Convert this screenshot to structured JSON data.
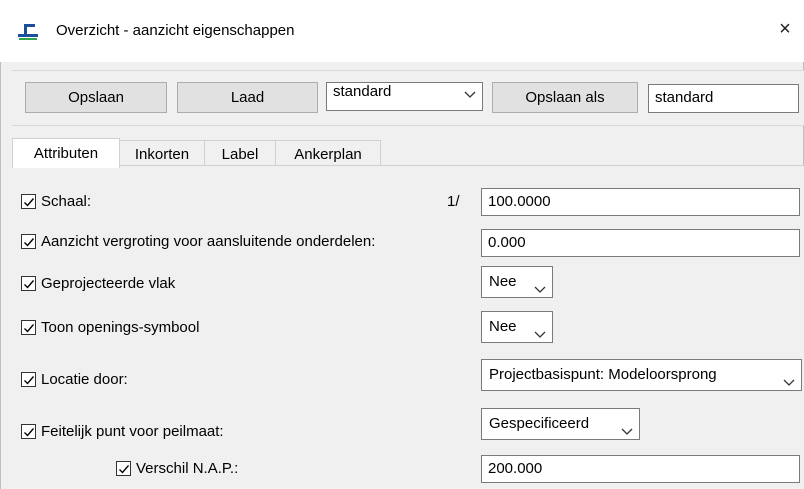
{
  "window": {
    "title": "Overzicht - aanzicht eigenschappen",
    "close_glyph": "×"
  },
  "toolbar": {
    "save_label": "Opslaan",
    "load_label": "Laad",
    "preset_select": "standard",
    "save_as_label": "Opslaan als",
    "save_as_name": "standard"
  },
  "tabs": [
    {
      "label": "Attributen",
      "active": true
    },
    {
      "label": "Inkorten",
      "active": false
    },
    {
      "label": "Label",
      "active": false
    },
    {
      "label": "Ankerplan",
      "active": false
    }
  ],
  "attributes": {
    "schaal": {
      "label": "Schaal:",
      "checked": true,
      "prefix": "1/",
      "value": "100.0000"
    },
    "vergroting": {
      "label": "Aanzicht vergroting voor aansluitende onderdelen:",
      "checked": true,
      "value": "0.000"
    },
    "geprojecteerde": {
      "label": "Geprojecteerde vlak",
      "checked": true,
      "value": "Nee"
    },
    "openings": {
      "label": "Toon openings-symbool",
      "checked": true,
      "value": "Nee"
    },
    "locatie": {
      "label": "Locatie door:",
      "checked": true,
      "value": "Projectbasispunt: Modeloorsprong"
    },
    "feitelijk": {
      "label": "Feitelijk punt voor peilmaat:",
      "checked": true,
      "value": "Gespecificeerd"
    },
    "nap": {
      "label": "Verschil N.A.P.:",
      "checked": true,
      "value": "200.000"
    }
  },
  "icons": {
    "app": "app-window-icon",
    "check": "checkmark-icon",
    "chevron": "chevron-down-icon"
  }
}
